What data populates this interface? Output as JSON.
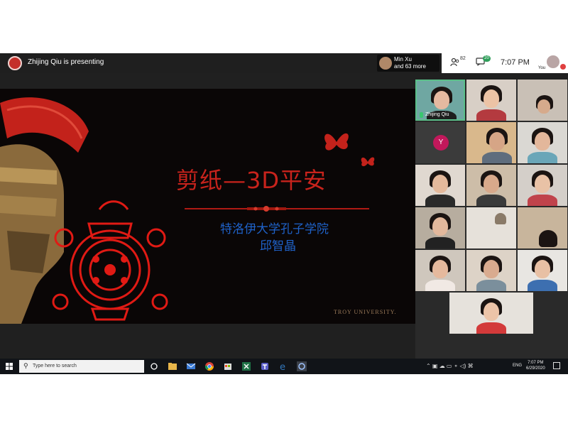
{
  "topbar": {
    "presenter_text": "Zhijing Qiu is presenting",
    "viewer_name": "Min Xu",
    "viewer_more": "and 63 more",
    "people_count": "82",
    "chat_count": "20",
    "time": "7:07 PM",
    "you_label": "You"
  },
  "slide": {
    "title": "剪纸—3D平安",
    "subtitle_line1": "特洛伊大学孔子学院",
    "subtitle_line2": "邱智晶",
    "logo_text": "TROY UNIVERSITY."
  },
  "participants": {
    "active_speaker_name": "Zhijing Qiu",
    "y_avatar_letter": "Y"
  },
  "taskbar": {
    "search_placeholder": "Type here to search",
    "language": "ENG",
    "time": "7:07 PM",
    "date": "6/29/2020"
  },
  "colors": {
    "slide_title": "#c8231c",
    "slide_subtitle": "#1f62c9",
    "chat_badge": "#2f9e5a",
    "y_avatar": "#c2185b"
  }
}
